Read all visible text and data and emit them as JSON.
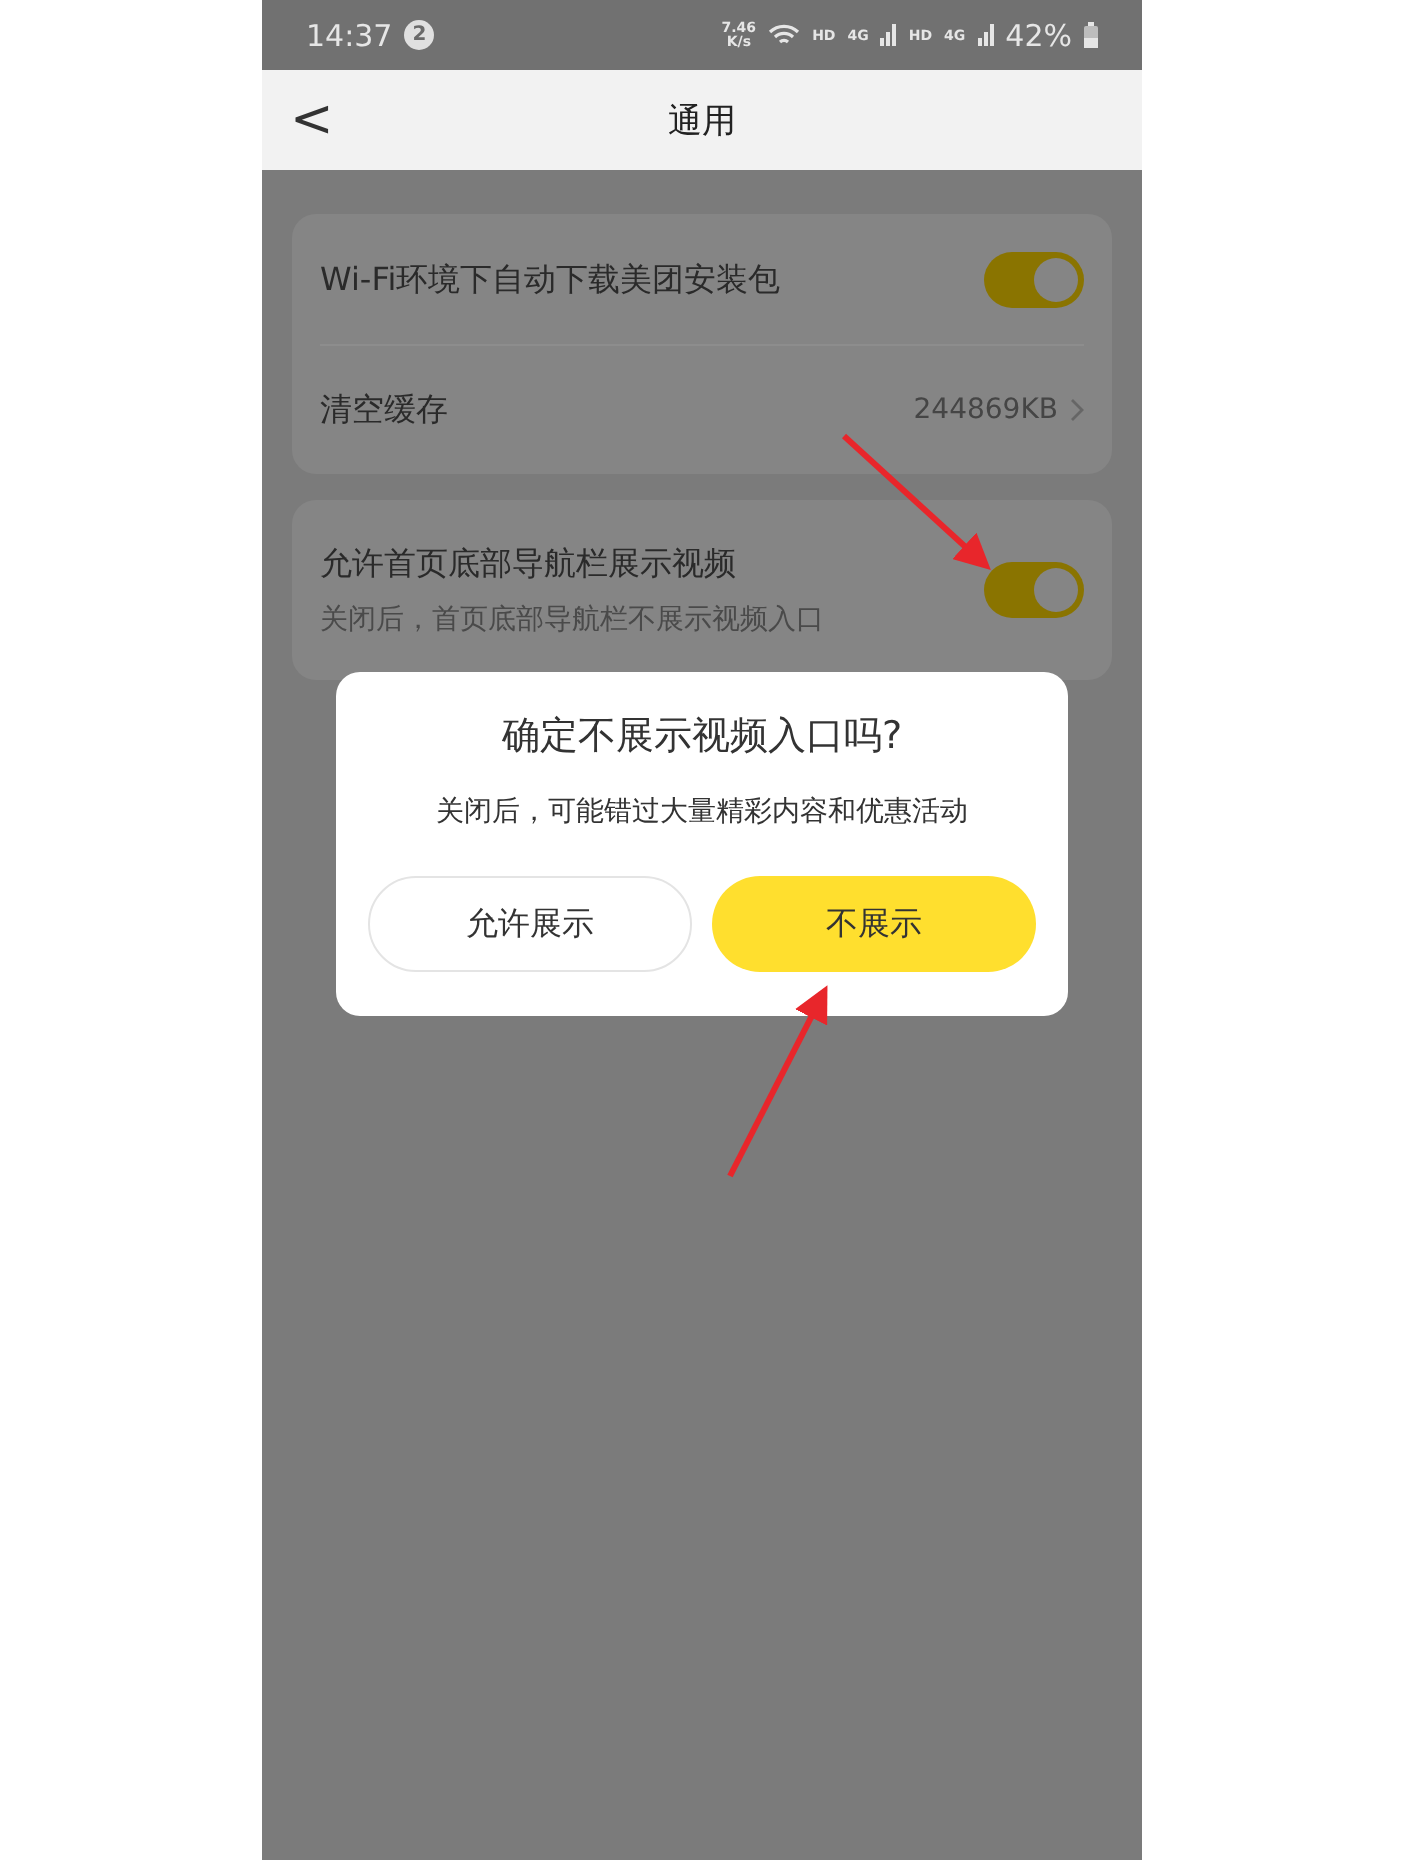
{
  "status_bar": {
    "time": "14:37",
    "notification_count": "2",
    "speed_value": "7.46",
    "speed_unit": "K/s",
    "sims": [
      {
        "hd": "HD",
        "network": "4G"
      },
      {
        "hd": "HD",
        "network": "4G"
      }
    ],
    "battery": "42%"
  },
  "nav_bar": {
    "back": "<",
    "title": "通用"
  },
  "cards": [
    {
      "rows": [
        {
          "kind": "toggle",
          "label": "Wi-Fi环境下自动下载美团安装包",
          "on": true
        },
        {
          "kind": "link",
          "label": "清空缓存",
          "value": "244869KB"
        }
      ]
    },
    {
      "rows": [
        {
          "kind": "toggle",
          "label": "允许首页底部导航栏展示视频",
          "subtitle": "关闭后，首页底部导航栏不展示视频入口",
          "on": true
        }
      ]
    }
  ],
  "dialog": {
    "title": "确定不展示视频入口吗?",
    "message": "关闭后，可能错过大量精彩内容和优惠活动",
    "buttons": [
      {
        "label": "允许展示",
        "primary": false
      },
      {
        "label": "不展示",
        "primary": true
      }
    ]
  }
}
